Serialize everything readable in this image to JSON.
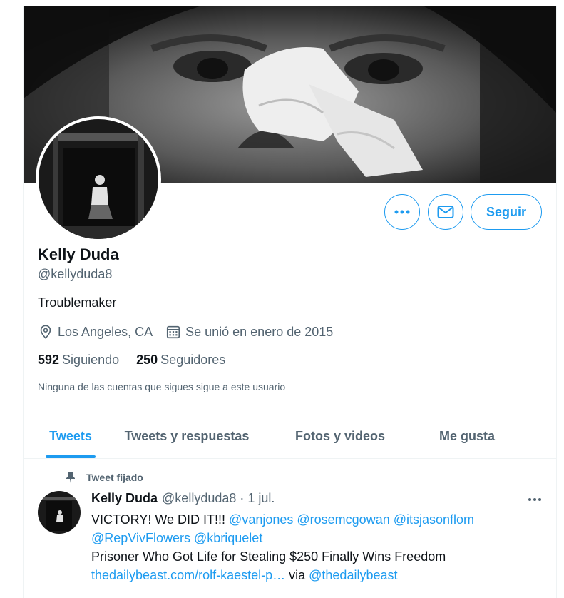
{
  "profile": {
    "name": "Kelly Duda",
    "handle": "@kellyduda8",
    "bio": "Troublemaker",
    "location": "Los Angeles, CA",
    "joined": "Se unió en enero de 2015",
    "following_count": "592",
    "following_label": "Siguiendo",
    "followers_count": "250",
    "followers_label": "Seguidores",
    "followed_by_note": "Ninguna de las cuentas que sigues sigue a este usuario"
  },
  "actions": {
    "more_icon": "more-horizontal-icon",
    "message_icon": "envelope-icon",
    "follow_label": "Seguir"
  },
  "tabs": [
    {
      "label": "Tweets",
      "active": true
    },
    {
      "label": "Tweets y respuestas",
      "active": false
    },
    {
      "label": "Fotos y videos",
      "active": false
    },
    {
      "label": "Me gusta",
      "active": false
    }
  ],
  "pinned_tweet": {
    "pinned_label": "Tweet fijado",
    "author_name": "Kelly Duda",
    "author_handle": "@kellyduda8",
    "separator": "·",
    "date": "1 jul.",
    "line1_text": "VICTORY!  We DID IT!!! ",
    "mention1": "@vanjones",
    "mention2": "@rosemcgowan",
    "mention3": "@itsjasonflom",
    "mention4": "@RepVivFlowers",
    "mention5": "@kbriquelet",
    "line3_text": "Prisoner Who Got Life for Stealing $250 Finally Wins Freedom",
    "link_text": "thedailybeast.com/rolf-kaestel-p…",
    "via_text": " via ",
    "via_mention": "@thedailybeast"
  },
  "colors": {
    "accent": "#1d9bf0",
    "text_primary": "#0f1419",
    "text_secondary": "#536471",
    "border": "#eff3f4"
  }
}
